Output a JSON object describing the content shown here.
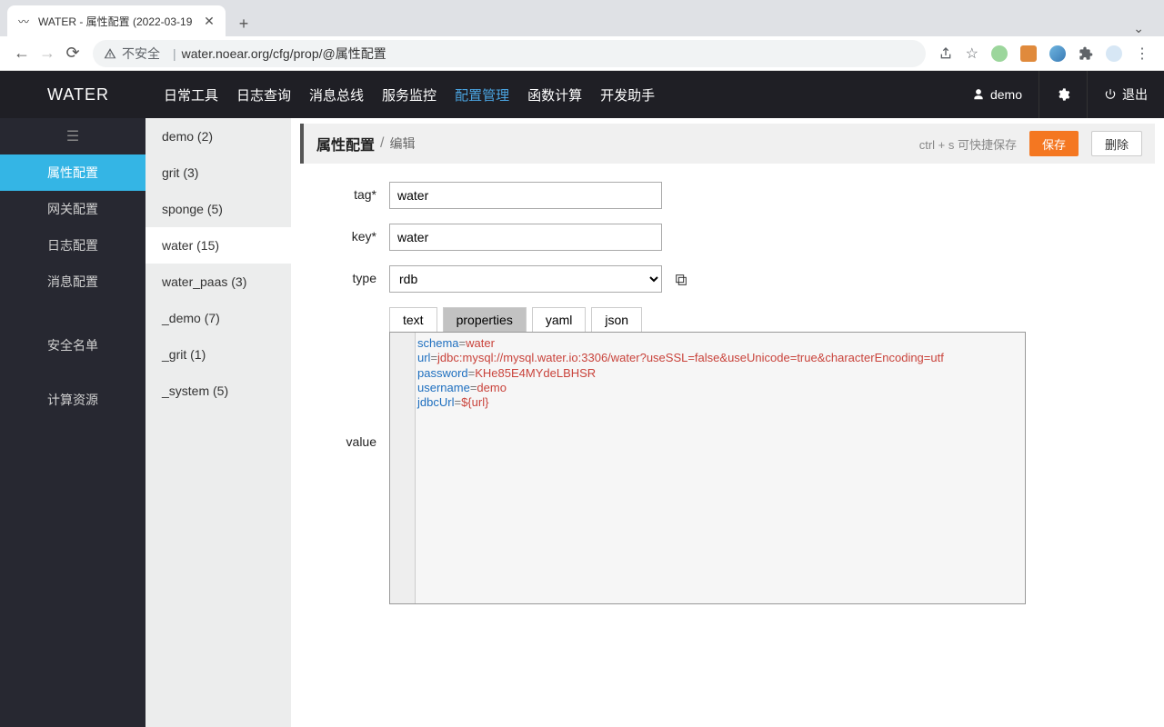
{
  "browser": {
    "tab_title": "WATER - 属性配置 (2022-03-19",
    "url_insecure": "不安全",
    "url": "water.noear.org/cfg/prop/@属性配置"
  },
  "header": {
    "logo": "WATER",
    "nav": [
      "日常工具",
      "日志查询",
      "消息总线",
      "服务监控",
      "配置管理",
      "函数计算",
      "开发助手"
    ],
    "nav_active_index": 4,
    "user": "demo",
    "logout": "退出"
  },
  "sidebar_left": {
    "items": [
      "属性配置",
      "网关配置",
      "日志配置",
      "消息配置"
    ],
    "items2": [
      "安全名单",
      "计算资源"
    ],
    "active_index": 0
  },
  "sidebar_tags": {
    "items": [
      {
        "label": "demo (2)"
      },
      {
        "label": "grit (3)"
      },
      {
        "label": "sponge (5)"
      },
      {
        "label": "water (15)"
      },
      {
        "label": "water_paas (3)"
      },
      {
        "label": "_demo (7)"
      },
      {
        "label": "_grit (1)"
      },
      {
        "label": "_system (5)"
      }
    ],
    "active_index": 3
  },
  "page": {
    "title": "属性配置",
    "subtitle": "编辑",
    "hint": "ctrl + s 可快捷保存",
    "save_label": "保存",
    "delete_label": "删除"
  },
  "form": {
    "tag_label": "tag*",
    "tag_value": "water",
    "key_label": "key*",
    "key_value": "water",
    "type_label": "type",
    "type_value": "rdb",
    "type_options": [
      "rdb"
    ],
    "value_label": "value",
    "format_tabs": [
      "text",
      "properties",
      "yaml",
      "json"
    ],
    "format_active_index": 1,
    "code_lines": [
      {
        "key": "schema",
        "val": "water"
      },
      {
        "key": "url",
        "val": "jdbc:mysql://mysql.water.io:3306/water?useSSL=false&useUnicode=true&characterEncoding=utf"
      },
      {
        "key": "password",
        "val": "KHe85E4MYdeLBHSR"
      },
      {
        "key": "username",
        "val": "demo"
      },
      {
        "key": "jdbcUrl",
        "val": "${url}"
      }
    ]
  }
}
